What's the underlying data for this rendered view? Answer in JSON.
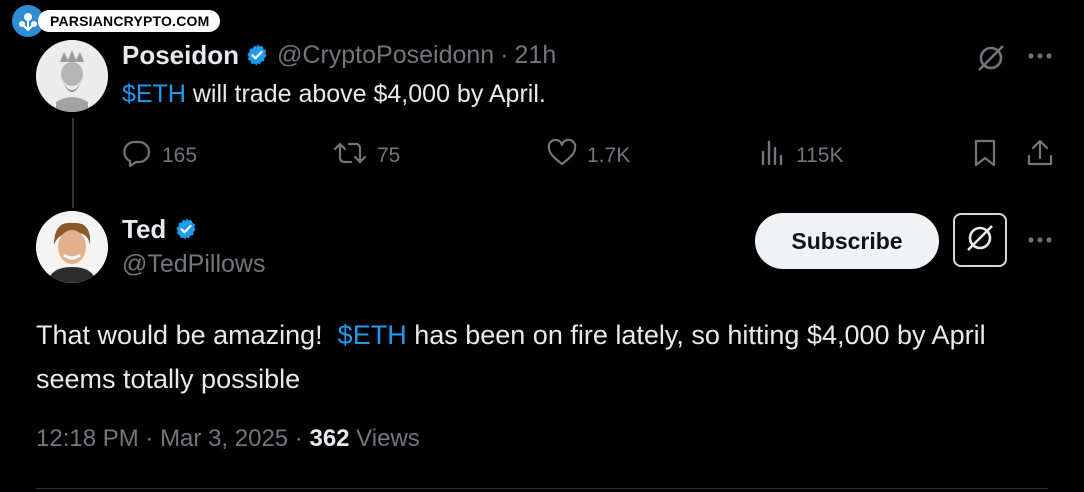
{
  "watermark": {
    "text": "PARSIANCRYPTO.COM"
  },
  "quoted_tweet": {
    "name": "Poseidon",
    "handle": "@CryptoPoseidonn",
    "separator": "·",
    "time": "21h",
    "text_ticker": "$ETH",
    "text_rest": " will trade above $4,000 by April.",
    "actions": {
      "replies": "165",
      "reposts": "75",
      "likes": "1.7K",
      "views": "115K"
    }
  },
  "main_tweet": {
    "name": "Ted",
    "handle": "@TedPillows",
    "subscribe_label": "Subscribe",
    "text_before": "That would be amazing!  ",
    "text_ticker": "$ETH",
    "text_after": " has been on fire lately, so hitting $4,000 by April seems totally possible",
    "time": "12:18 PM",
    "sep1": " · ",
    "date": "Mar 3, 2025",
    "sep2": " · ",
    "views_count": "362",
    "views_label": " Views"
  },
  "icons": [
    "verified-badge-icon",
    "grok-icon",
    "more-icon",
    "reply-icon",
    "repost-icon",
    "like-icon",
    "views-icon",
    "bookmark-icon",
    "share-icon"
  ],
  "colors": {
    "background": "#000000",
    "accent": "#1d9bf0",
    "muted": "#71767b",
    "text": "#e7e9ea"
  }
}
